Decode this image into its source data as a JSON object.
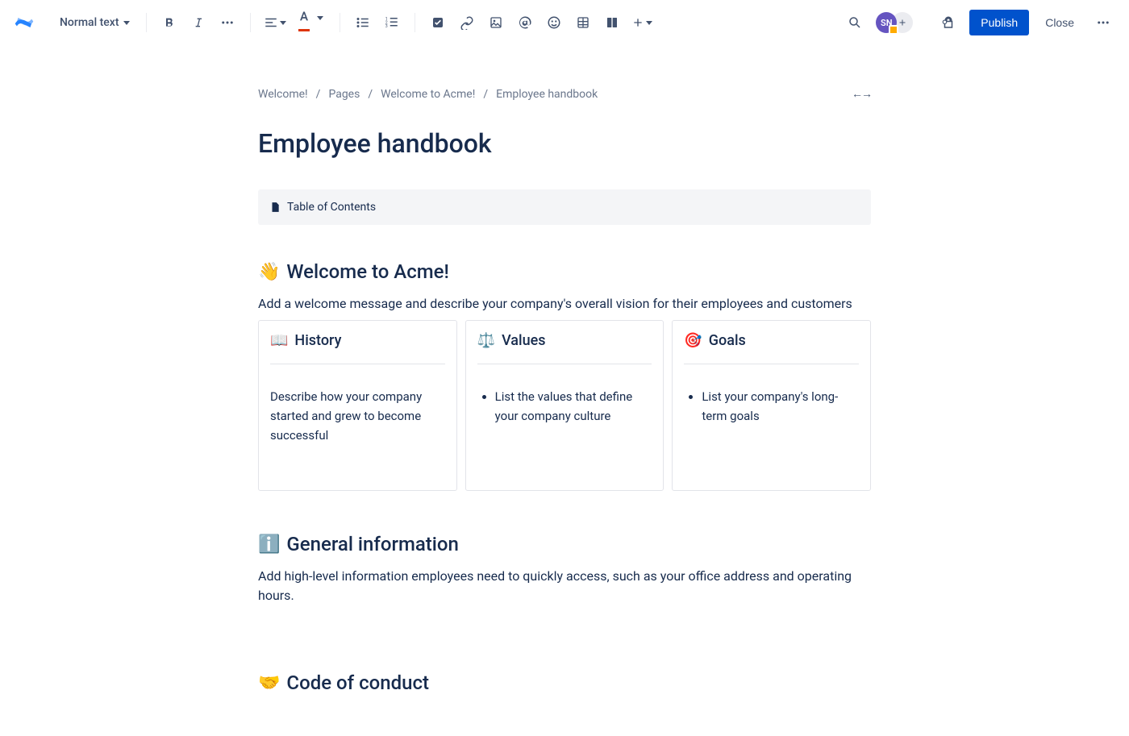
{
  "toolbar": {
    "textStyle": "Normal text",
    "publish": "Publish",
    "close": "Close"
  },
  "avatar": {
    "initials": "SN"
  },
  "breadcrumbs": {
    "items": [
      "Welcome!",
      "Pages",
      "Welcome to Acme!",
      "Employee handbook"
    ]
  },
  "page": {
    "title": "Employee handbook"
  },
  "toc": {
    "label": "Table of Contents"
  },
  "sections": {
    "welcome": {
      "emoji": "👋",
      "title": "Welcome to Acme!",
      "body": "Add a welcome message and describe your company's overall vision for their employees and customers"
    },
    "cards": [
      {
        "emoji": "📖",
        "title": "History",
        "body": "Describe how your company started and grew to become successful",
        "type": "text"
      },
      {
        "emoji": "⚖️",
        "title": "Values",
        "body": "List the values that define your company culture",
        "type": "list"
      },
      {
        "emoji": "🎯",
        "title": "Goals",
        "body": "List your company's long-term goals",
        "type": "list"
      }
    ],
    "generalInfo": {
      "emoji": "ℹ️",
      "title": "General information",
      "body": "Add high-level information employees need to quickly access, such as your office address and operating hours."
    },
    "codeOfConduct": {
      "emoji": "🤝",
      "title": "Code of conduct"
    }
  }
}
